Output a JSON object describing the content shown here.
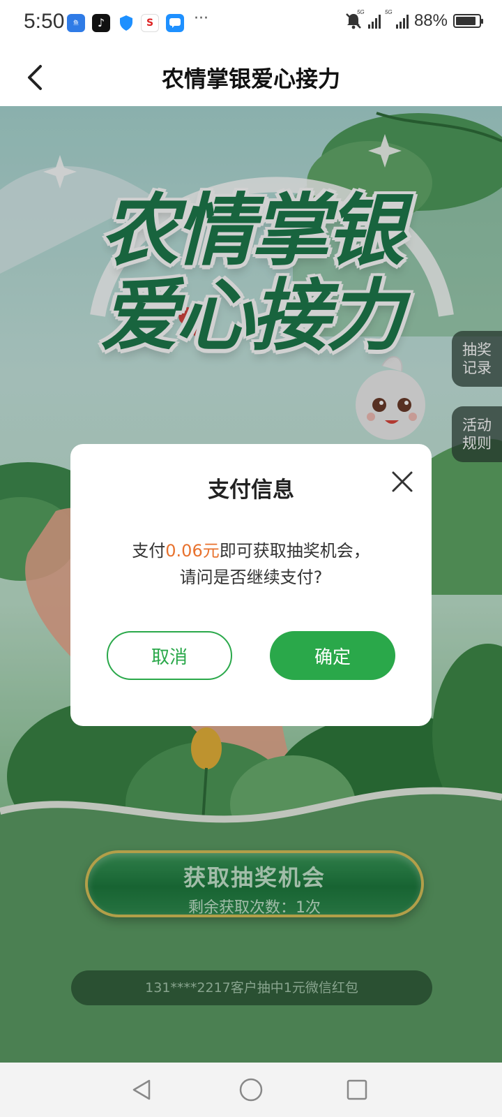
{
  "status_bar": {
    "time": "5:50",
    "overflow": "···",
    "signal_tag_1": "5G",
    "signal_tag_2": "5G",
    "battery_percent": "88%",
    "battery_level": 0.88,
    "app_icons": [
      "alipay-like-icon",
      "tiktok-icon",
      "shield-icon",
      "bank-icon",
      "message-icon"
    ]
  },
  "header": {
    "title": "农情掌银爱心接力",
    "back_icon": "chevron-left-icon"
  },
  "banner": {
    "line1": "农情掌银",
    "line2": "爱心接力"
  },
  "side_tabs": {
    "records": "抽奖记录",
    "rules": "活动规则"
  },
  "main_button": {
    "label": "获取抽奖机会",
    "remaining": "剩余获取次数：1次"
  },
  "ticker": {
    "text": "131****2217客户抽中1元微信红包"
  },
  "dialog": {
    "title": "支付信息",
    "msg_prefix": "支付",
    "amount": "0.06元",
    "msg_suffix": "即可获取抽奖机会，",
    "msg_line2": "请问是否继续支付?",
    "cancel_label": "取消",
    "confirm_label": "确定"
  },
  "colors": {
    "accent": "#2aa84a",
    "amount": "#e8722e",
    "title_green": "#1e7a4c"
  },
  "nav_bar": {
    "icons": [
      "back-triangle-icon",
      "home-circle-icon",
      "recent-square-icon"
    ]
  }
}
